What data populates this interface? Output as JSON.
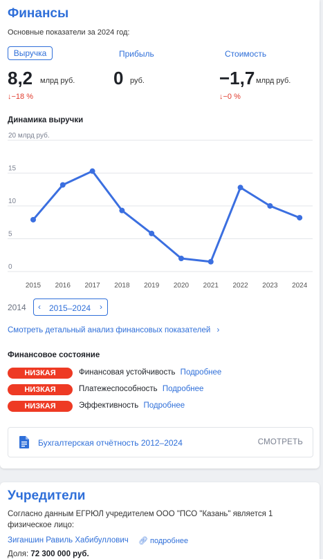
{
  "finance": {
    "title": "Финансы",
    "subtitle": "Основные показатели за 2024 год:",
    "tabs": [
      "Выручка",
      "Прибыль",
      "Стоимость"
    ],
    "metrics": [
      {
        "value": "8,2",
        "unit": "млрд руб.",
        "delta": "↓−18 %"
      },
      {
        "value": "0",
        "unit": "руб."
      },
      {
        "value": "−1,7",
        "unit": "млрд руб.",
        "delta": "↓−0 %"
      }
    ],
    "chart_title": "Динамика выручки",
    "range_start": "2014",
    "range_label": "2015–2024",
    "detail_link": "Смотреть детальный анализ финансовых показателей",
    "state_title": "Финансовое состояние",
    "states": [
      {
        "badge": "НИЗКАЯ",
        "label": "Финансовая устойчивость",
        "more": "Подробнее"
      },
      {
        "badge": "НИЗКАЯ",
        "label": "Платежеспособность",
        "more": "Подробнее"
      },
      {
        "badge": "НИЗКАЯ",
        "label": "Эффективность",
        "more": "Подробнее"
      }
    ],
    "report": {
      "title": "Бухгалтерская отчётность 2012–2024",
      "button": "СМОТРЕТЬ"
    }
  },
  "owners": {
    "title": "Учредители",
    "text": "Согласно данным ЕГРЮЛ учредителем ООО \"ПСО \"Казань\" является 1 физическое лицо:",
    "person": "Зиганшин Равиль Хабибуллович",
    "more": "подробнее",
    "share_label": "Доля:",
    "share_value": "72 300 000 руб."
  },
  "colors": {
    "accent": "#2f6fd9",
    "danger": "#ee3a24",
    "delta": "#e0392b",
    "line": "#3b6fe0"
  },
  "chart_data": {
    "type": "line",
    "title": "Динамика выручки",
    "x": [
      "2015",
      "2016",
      "2017",
      "2018",
      "2019",
      "2020",
      "2021",
      "2022",
      "2023",
      "2024"
    ],
    "series": [
      {
        "values": [
          7.9,
          13.2,
          15.3,
          9.3,
          5.8,
          2.0,
          1.5,
          12.8,
          10.0,
          8.2
        ]
      }
    ],
    "yticks": [
      {
        "value": 0,
        "label": "0"
      },
      {
        "value": 5,
        "label": "5"
      },
      {
        "value": 10,
        "label": "10"
      },
      {
        "value": 15,
        "label": "15"
      },
      {
        "value": 20,
        "label": "20 млрд руб."
      }
    ],
    "ylim": [
      0,
      20
    ],
    "grid": true
  }
}
